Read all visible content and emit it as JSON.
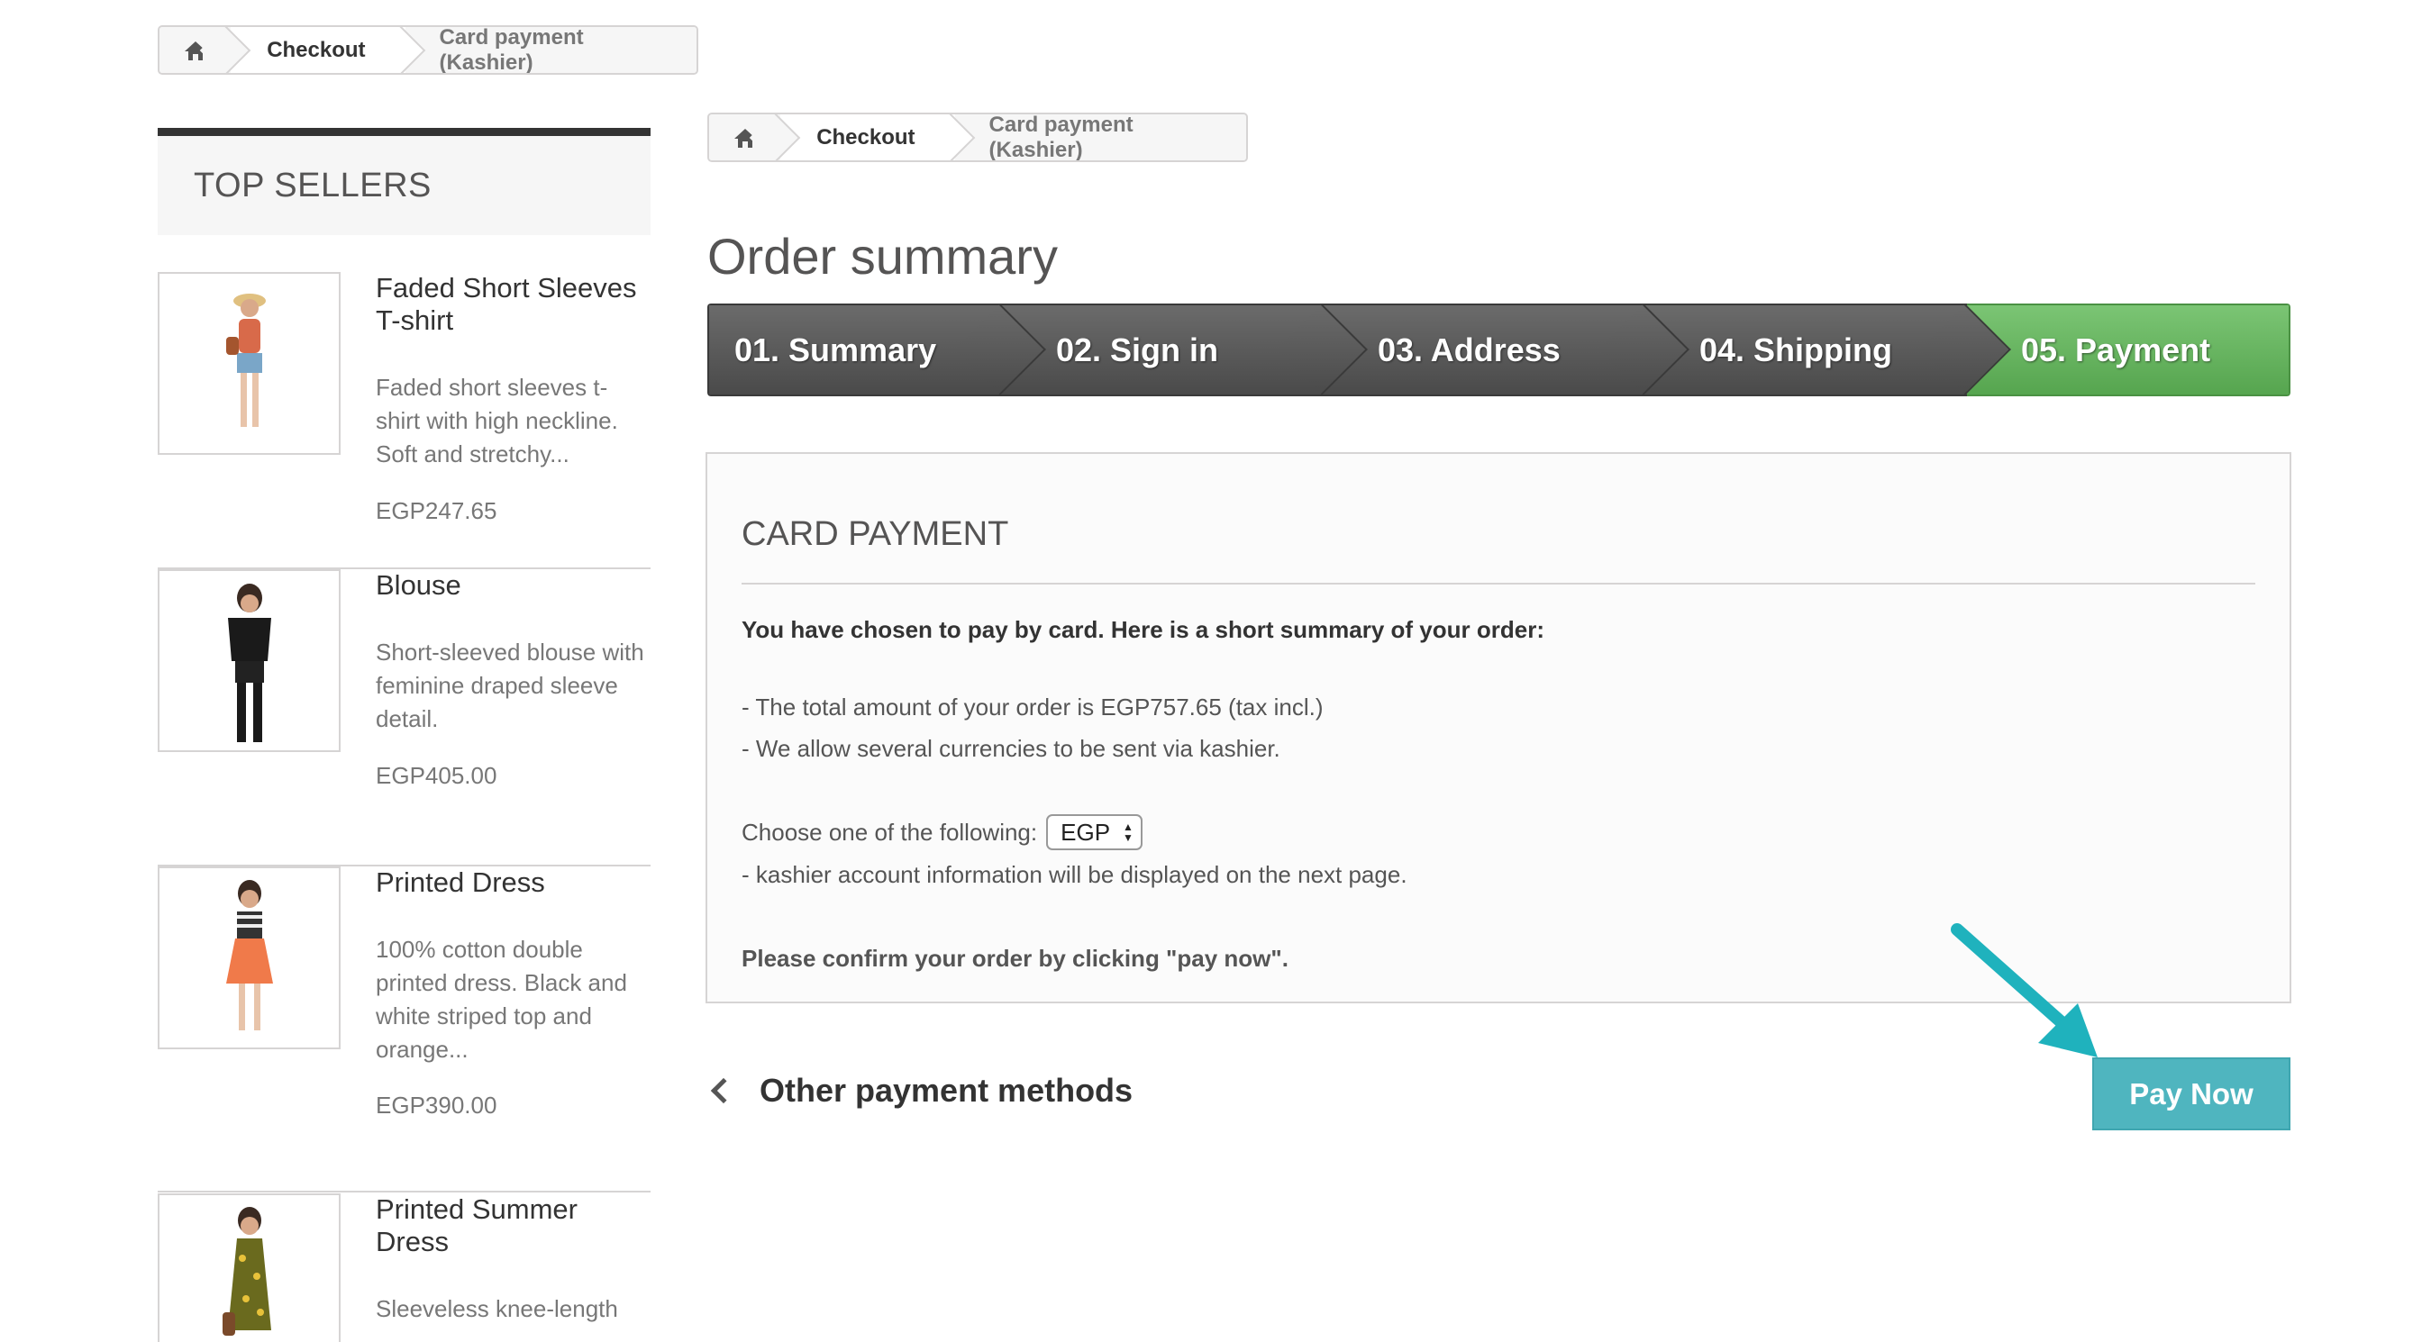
{
  "breadcrumb_top": {
    "home_icon": "home-icon",
    "checkout": "Checkout",
    "current": "Card payment (Kashier)"
  },
  "breadcrumb_main": {
    "home_icon": "home-icon",
    "checkout": "Checkout",
    "current": "Card payment (Kashier)"
  },
  "sidebar": {
    "title": "TOP SELLERS",
    "products": [
      {
        "name": "Faded Short Sleeves T-shirt",
        "description": "Faded short sleeves t-shirt with high neckline. Soft and stretchy...",
        "price": "EGP247.65"
      },
      {
        "name": "Blouse",
        "description": "Short-sleeved blouse with feminine draped sleeve detail.",
        "price": "EGP405.00"
      },
      {
        "name": "Printed Dress",
        "description": "100% cotton double printed dress. Black and white striped top and orange...",
        "price": "EGP390.00"
      },
      {
        "name": "Printed Summer Dress",
        "description": "Sleeveless knee-length",
        "price": ""
      }
    ]
  },
  "main": {
    "title": "Order summary",
    "steps": [
      "01. Summary",
      "02. Sign in",
      "03. Address",
      "04. Shipping",
      "05. Payment"
    ],
    "card_payment": {
      "heading": "CARD PAYMENT",
      "intro": "You have chosen to pay by card. Here is a short summary of your order:",
      "total_line": "- The total amount of your order is EGP757.65 (tax incl.)",
      "currencies_line": "- We allow several currencies to be sent via kashier.",
      "choose_label": "Choose one of the following:",
      "currency_selected": "EGP",
      "info_line": "- kashier account information will be displayed on the next page.",
      "confirm_line": "Please confirm your order by clicking \"pay now\"."
    },
    "other_methods": "Other payment methods",
    "pay_now": "Pay Now"
  },
  "colors": {
    "accent_teal": "#4fb5bf",
    "step_active": "#5cb356",
    "annotation_arrow": "#1fb2bd"
  }
}
